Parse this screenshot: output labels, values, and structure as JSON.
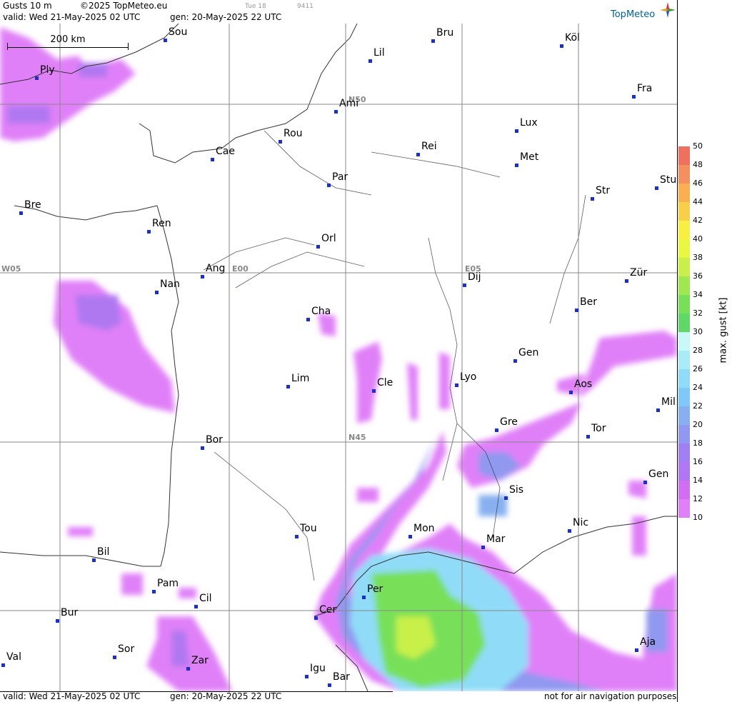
{
  "header": {
    "title": "Gusts 10 m",
    "copyright": "©2025 TopMeteo.eu",
    "day": "Tue 18",
    "code": "9411",
    "valid": "valid:  Wed  21-May-2025  02 UTC",
    "gen": "gen: 20-May-2025 22 UTC",
    "logo": "TopMeteo"
  },
  "footer": {
    "valid": "valid:  Wed  21-May-2025  02 UTC",
    "gen": "gen: 20-May-2025 22 UTC",
    "note": "not for air navigation purposes"
  },
  "scale_label": "200 km",
  "grid_labels": {
    "n50": "N50",
    "n45": "N45",
    "w05": "W05",
    "e00": "E00",
    "e05": "E05"
  },
  "cities": [
    {
      "name": "Sou"
    },
    {
      "name": "Bru"
    },
    {
      "name": "Köl"
    },
    {
      "name": "Ply"
    },
    {
      "name": "Lil"
    },
    {
      "name": "Ami"
    },
    {
      "name": "Fra"
    },
    {
      "name": "Lux"
    },
    {
      "name": "Rou"
    },
    {
      "name": "Rei"
    },
    {
      "name": "Cae"
    },
    {
      "name": "Met"
    },
    {
      "name": "Par"
    },
    {
      "name": "Stu"
    },
    {
      "name": "Str"
    },
    {
      "name": "Bre"
    },
    {
      "name": "Ren"
    },
    {
      "name": "Orl"
    },
    {
      "name": "Ang"
    },
    {
      "name": "Dij"
    },
    {
      "name": "Zür"
    },
    {
      "name": "Nan"
    },
    {
      "name": "Ber"
    },
    {
      "name": "Cha"
    },
    {
      "name": "Gen"
    },
    {
      "name": "Lim"
    },
    {
      "name": "Cle"
    },
    {
      "name": "Lyo"
    },
    {
      "name": "Aos"
    },
    {
      "name": "Mil"
    },
    {
      "name": "Gre"
    },
    {
      "name": "Tor"
    },
    {
      "name": "Bor"
    },
    {
      "name": "Gen"
    },
    {
      "name": "Sis"
    },
    {
      "name": "Tou"
    },
    {
      "name": "Mon"
    },
    {
      "name": "Nic"
    },
    {
      "name": "Mar"
    },
    {
      "name": "Bil"
    },
    {
      "name": "Pam"
    },
    {
      "name": "Per"
    },
    {
      "name": "Cil"
    },
    {
      "name": "Bur"
    },
    {
      "name": "Cer"
    },
    {
      "name": "Sor"
    },
    {
      "name": "Aja"
    },
    {
      "name": "Val"
    },
    {
      "name": "Zar"
    },
    {
      "name": "Igu"
    },
    {
      "name": "Bar"
    }
  ],
  "legend": {
    "title": "max. gust  [kt]",
    "ticks": [
      "50",
      "48",
      "46",
      "44",
      "42",
      "40",
      "38",
      "36",
      "34",
      "32",
      "30",
      "28",
      "26",
      "24",
      "22",
      "20",
      "18",
      "16",
      "14",
      "12",
      "10"
    ],
    "colors": [
      "#f07060",
      "#f49060",
      "#f8b050",
      "#f8d048",
      "#f8f040",
      "#e8f840",
      "#c8f048",
      "#a0e850",
      "#78e058",
      "#60d868",
      "#c8f8f8",
      "#a8ecf8",
      "#90dcf8",
      "#80c8f8",
      "#88b0f0",
      "#9098f0",
      "#a080f0",
      "#b078f0",
      "#d070f0",
      "#e080f8"
    ]
  }
}
